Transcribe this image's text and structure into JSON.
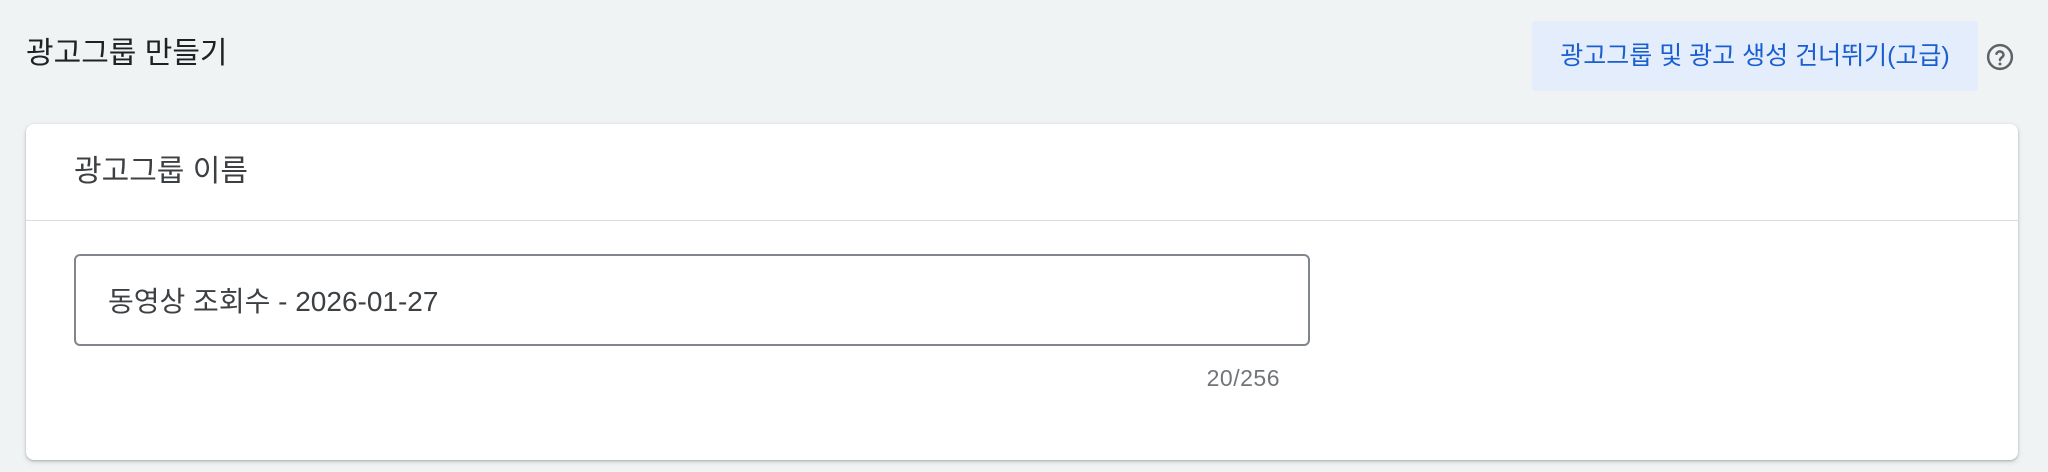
{
  "header": {
    "title": "광고그룹 만들기",
    "skip_button_label": "광고그룹 및 광고 생성 건너뛰기(고급)",
    "help_icon": "help-circle-icon"
  },
  "ad_group_card": {
    "title": "광고그룹 이름",
    "name_input_value": "동영상 조회수 - 2026-01-27",
    "char_counter": "20/256"
  },
  "colors": {
    "page_background": "#f0f3f4",
    "card_background": "#ffffff",
    "link_blue": "#1a5fd0",
    "skip_button_background": "#e4edfb",
    "input_border": "#80868b",
    "divider": "#dadce0",
    "muted_text": "#70757a"
  }
}
